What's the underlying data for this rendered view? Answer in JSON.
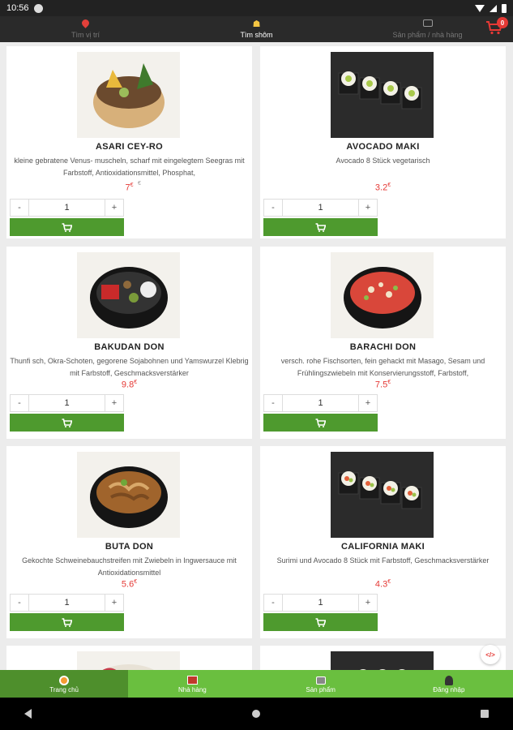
{
  "status_bar": {
    "time": "10:56"
  },
  "top_nav": {
    "tabs": [
      {
        "label": "Tìm vị trí",
        "icon": "location-pin-icon",
        "active": false
      },
      {
        "label": "Tìm shôm",
        "icon": "people-icon",
        "active": true
      },
      {
        "label": "Sản phẩm / nhà hàng",
        "icon": "box-icon",
        "active": false
      }
    ],
    "cart_count": "0"
  },
  "products": [
    {
      "name": "ASARI CEY-RO",
      "description": "kleine gebratene Venus- muscheln, scharf mit eingelegtem Seegras mit Farbstoff, Antioxidationsmittel, Phosphat,",
      "price": "7",
      "currency": "€",
      "qty": "1",
      "extra": "€"
    },
    {
      "name": "AVOCADO MAKI",
      "description": "Avocado 8 Stück vegetarisch",
      "price": "3.2",
      "currency": "€",
      "qty": "1"
    },
    {
      "name": "BAKUDAN DON",
      "description": "Thunfi sch, Okra-Schoten, gegorene Sojabohnen und Yamswurzel Klebrig mit Farbstoff, Geschmacksverstärker",
      "price": "9.8",
      "currency": "€",
      "qty": "1"
    },
    {
      "name": "BARACHI DON",
      "description": "versch. rohe Fischsorten, fein gehackt mit Masago, Sesam und Frühlingszwiebeln mit Konservierungsstoff, Farbstoff,",
      "price": "7.5",
      "currency": "€",
      "qty": "1"
    },
    {
      "name": "BUTA DON",
      "description": "Gekochte Schweinebauchstreifen mit Zwiebeln in Ingwersauce mit Antioxidationsmittel",
      "price": "5.6",
      "currency": "€",
      "qty": "1"
    },
    {
      "name": "CALIFORNIA MAKI",
      "description": "Surimi und Avocado 8 Stück mit Farbstoff, Geschmacksverstärker",
      "price": "4.3",
      "currency": "€",
      "qty": "1"
    }
  ],
  "stepper": {
    "minus": "-",
    "plus": "+"
  },
  "bottom_nav": {
    "items": [
      {
        "label": "Trang chủ",
        "active": true
      },
      {
        "label": "Nhà hàng",
        "active": false
      },
      {
        "label": "Sản phẩm",
        "active": false
      },
      {
        "label": "Đăng nhập",
        "active": false
      }
    ]
  },
  "colors": {
    "accent_green": "#4e9a2e",
    "nav_green": "#6abf3f",
    "price_red": "#e53935",
    "header_dark": "#2a2a2a"
  }
}
